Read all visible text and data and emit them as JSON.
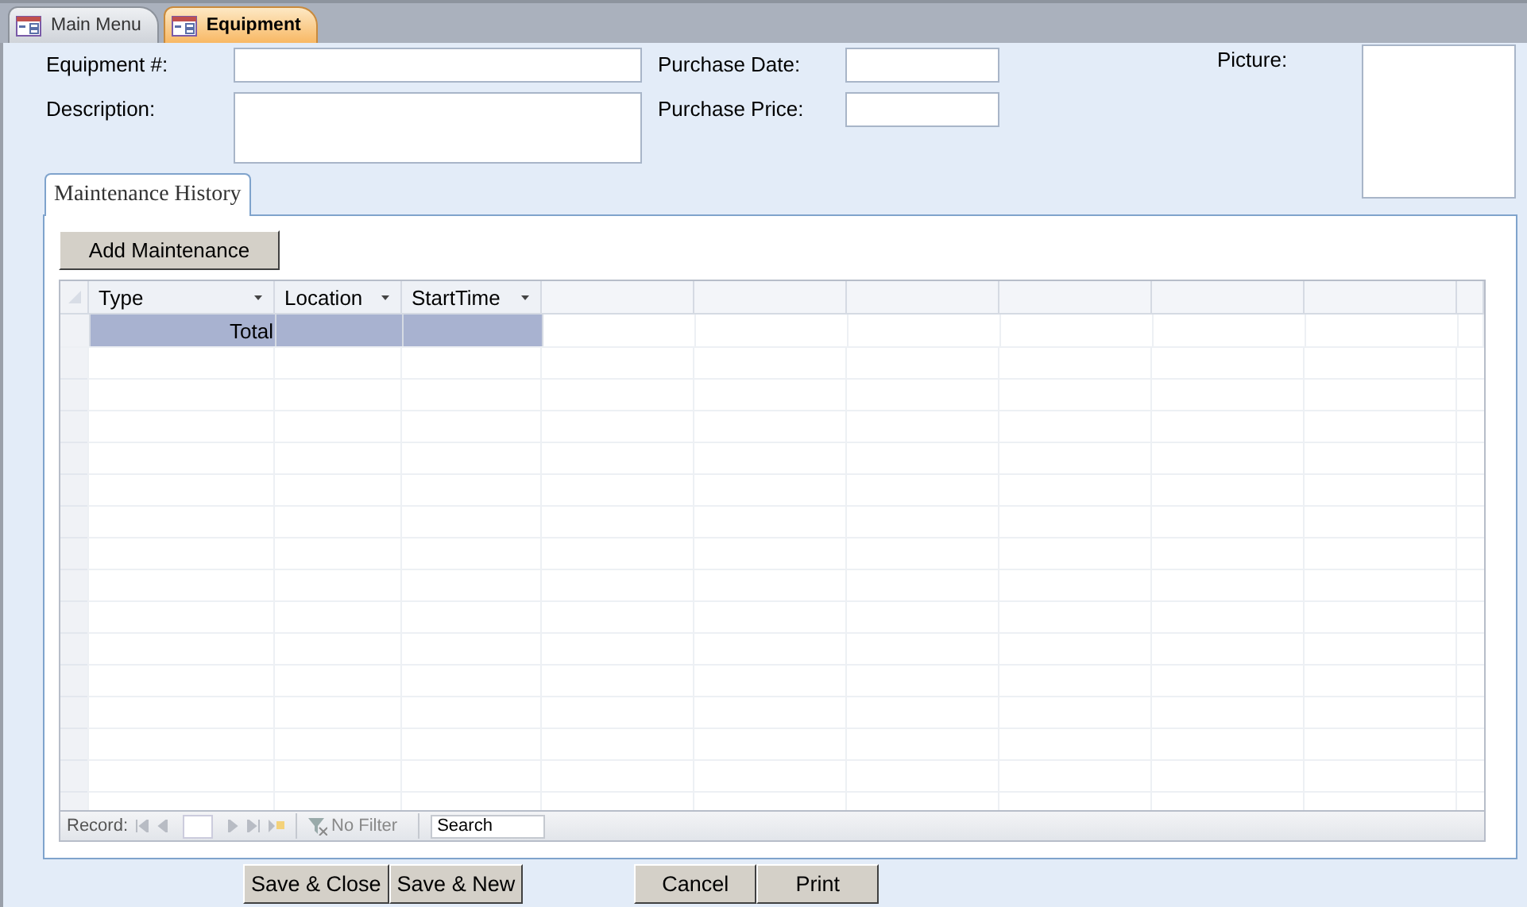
{
  "document_tabs": [
    {
      "label": "Main Menu",
      "selected": false
    },
    {
      "label": "Equipment",
      "selected": true
    }
  ],
  "fields": [
    {
      "label": "Equipment #:"
    },
    {
      "label": "Purchase Date:"
    },
    {
      "label": "Description:"
    },
    {
      "label": "Purchase Price:"
    }
  ],
  "picture": {
    "label": "Picture:"
  },
  "subform_tab": {
    "label": "Maintenance History",
    "selected": true
  },
  "add_button": "Add Maintenance",
  "datasheet": {
    "columns": [
      "Type",
      "Location",
      "StartTime"
    ],
    "total_label": "Total"
  },
  "navigation": {
    "record_label": "Record:",
    "filter": "No Filter",
    "search": {
      "placeholder": "Search"
    }
  },
  "buttons": [
    "Save & Close",
    "Save & New",
    "Cancel",
    "Print"
  ]
}
